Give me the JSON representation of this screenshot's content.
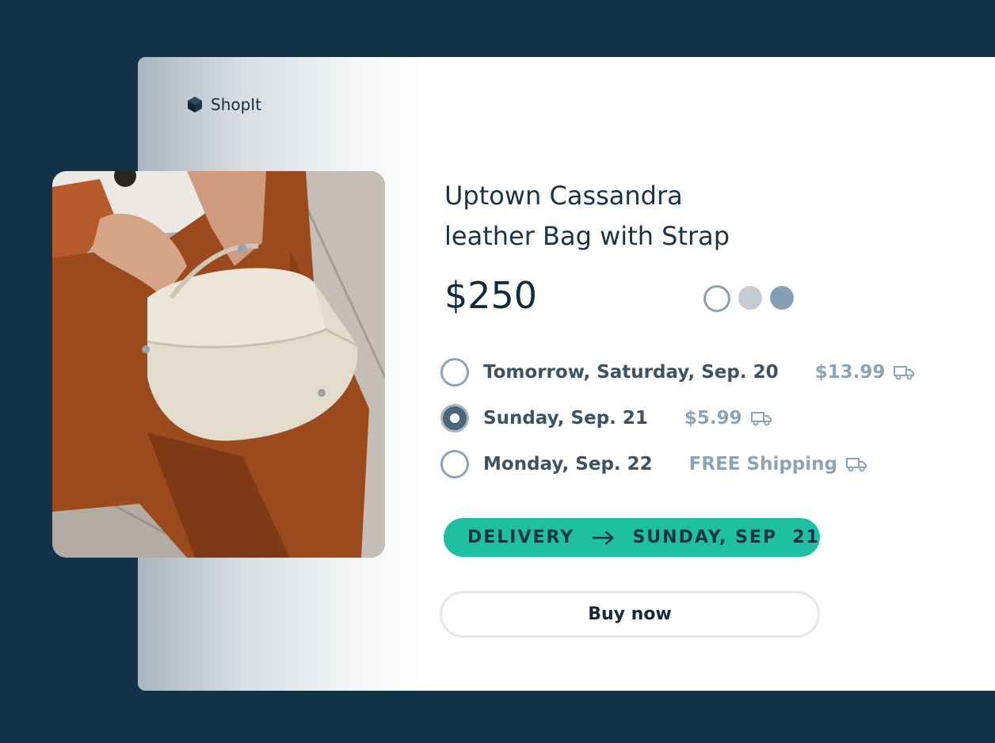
{
  "brand": {
    "name": "ShopIt",
    "icon": "cube-icon"
  },
  "product": {
    "title_line1": "Uptown Cassandra",
    "title_line2": "leather Bag with Strap",
    "price": "$250",
    "image": "photo of person holding cream leather bag",
    "colors": [
      "#ffffff",
      "#c4ccd2",
      "#85a0b6"
    ],
    "selected_color_index": 0
  },
  "shipping": {
    "options": [
      {
        "date": "Tomorrow, Saturday, Sep. 20",
        "price": "$13.99",
        "icon": "truck-icon",
        "selected": false
      },
      {
        "date": "Sunday, Sep. 21",
        "price": "$5.99",
        "icon": "truck-icon",
        "selected": true
      },
      {
        "date": "Monday, Sep. 22",
        "price": "FREE Shipping",
        "icon": "truck-icon",
        "selected": false
      }
    ]
  },
  "delivery": {
    "label": "DELIVERY",
    "date": "SUNDAY, SEP  21",
    "accent": "#1fbfa5"
  },
  "actions": {
    "buy_label": "Buy now"
  },
  "colors": {
    "background": "#123247",
    "text": "#1a3346",
    "muted": "#8ba4b6"
  }
}
